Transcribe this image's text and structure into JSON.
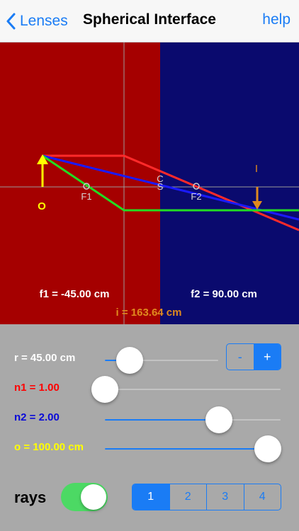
{
  "nav": {
    "back_label": "Lenses",
    "title": "Spherical Interface",
    "help_label": "help"
  },
  "sim": {
    "colors": {
      "medium1": "#a50000",
      "medium2": "#0a0a6e",
      "ray_red": "#ff2a2a",
      "ray_green": "#22dd22",
      "ray_blue": "#1a1aff",
      "object": "#ffff00",
      "image": "#e08a1e",
      "axis": "#9a9a9a",
      "label_white": "#ffffff"
    },
    "labels": {
      "object": "O",
      "image": "I",
      "center_c": "C",
      "center_s": "S",
      "focus1": "F1",
      "focus2": "F2",
      "f1": "f1 = -45.00 cm",
      "f2": "f2 = 90.00 cm",
      "image_distance": "i = 163.64 cm"
    }
  },
  "controls": {
    "r": {
      "label": "r = 45.00 cm",
      "value": 0.22,
      "color": "#ffffff"
    },
    "n1": {
      "label": "n1 = 1.00",
      "value": 0.0,
      "color": "#ff0000"
    },
    "n2": {
      "label": "n2 = 2.00",
      "value": 0.65,
      "color": "#0a0ad8"
    },
    "o": {
      "label": "o = 100.00 cm",
      "value": 1.0,
      "color": "#ffff00"
    },
    "stepper": {
      "minus": "-",
      "plus": "+"
    },
    "rays": {
      "label": "rays",
      "on": true
    },
    "ray_counts": [
      "1",
      "2",
      "3",
      "4"
    ],
    "ray_count_selected": 0
  }
}
